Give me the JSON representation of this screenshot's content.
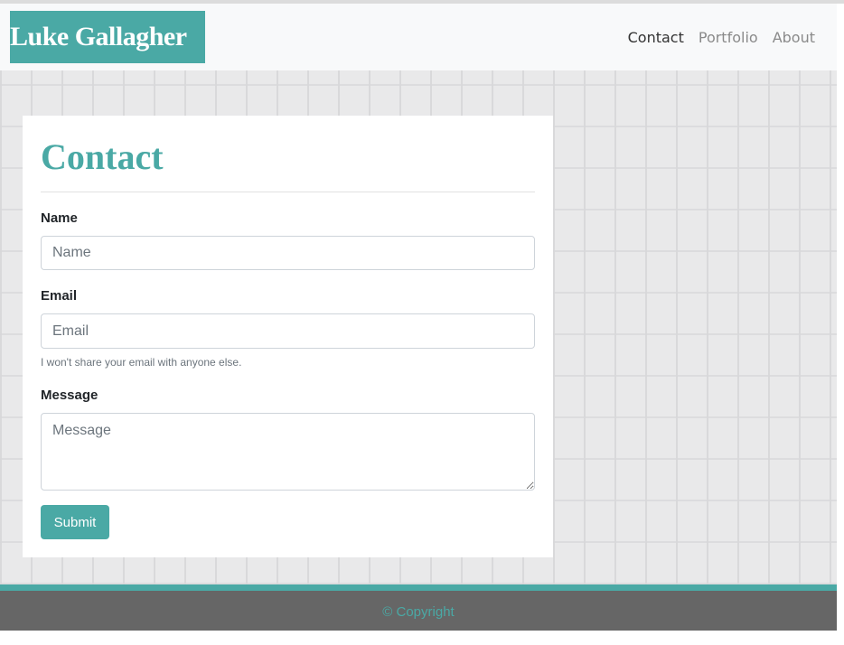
{
  "header": {
    "brand": "Luke Gallagher",
    "nav": [
      {
        "label": "Contact",
        "active": true
      },
      {
        "label": "Portfolio",
        "active": false
      },
      {
        "label": "About",
        "active": false
      }
    ]
  },
  "contact_form": {
    "title": "Contact",
    "name_label": "Name",
    "name_placeholder": "Name",
    "email_label": "Email",
    "email_placeholder": "Email",
    "email_help": "I won't share your email with anyone else.",
    "message_label": "Message",
    "message_placeholder": "Message",
    "submit_label": "Submit"
  },
  "footer": {
    "text": "© Copyright"
  },
  "colors": {
    "accent": "#4aa9a5",
    "footer_bg": "#666666",
    "navbar_bg": "#f8f9fa"
  }
}
